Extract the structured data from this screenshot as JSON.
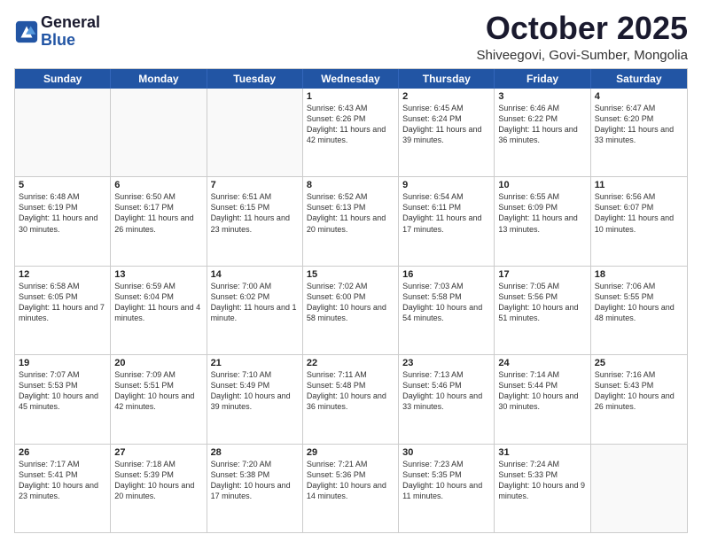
{
  "header": {
    "logo_general": "General",
    "logo_blue": "Blue",
    "month_title": "October 2025",
    "subtitle": "Shiveegovi, Govi-Sumber, Mongolia"
  },
  "days_of_week": [
    "Sunday",
    "Monday",
    "Tuesday",
    "Wednesday",
    "Thursday",
    "Friday",
    "Saturday"
  ],
  "rows": [
    [
      {
        "day": "",
        "sunrise": "",
        "sunset": "",
        "daylight": "",
        "empty": true
      },
      {
        "day": "",
        "sunrise": "",
        "sunset": "",
        "daylight": "",
        "empty": true
      },
      {
        "day": "",
        "sunrise": "",
        "sunset": "",
        "daylight": "",
        "empty": true
      },
      {
        "day": "1",
        "sunrise": "Sunrise: 6:43 AM",
        "sunset": "Sunset: 6:26 PM",
        "daylight": "Daylight: 11 hours and 42 minutes."
      },
      {
        "day": "2",
        "sunrise": "Sunrise: 6:45 AM",
        "sunset": "Sunset: 6:24 PM",
        "daylight": "Daylight: 11 hours and 39 minutes."
      },
      {
        "day": "3",
        "sunrise": "Sunrise: 6:46 AM",
        "sunset": "Sunset: 6:22 PM",
        "daylight": "Daylight: 11 hours and 36 minutes."
      },
      {
        "day": "4",
        "sunrise": "Sunrise: 6:47 AM",
        "sunset": "Sunset: 6:20 PM",
        "daylight": "Daylight: 11 hours and 33 minutes."
      }
    ],
    [
      {
        "day": "5",
        "sunrise": "Sunrise: 6:48 AM",
        "sunset": "Sunset: 6:19 PM",
        "daylight": "Daylight: 11 hours and 30 minutes."
      },
      {
        "day": "6",
        "sunrise": "Sunrise: 6:50 AM",
        "sunset": "Sunset: 6:17 PM",
        "daylight": "Daylight: 11 hours and 26 minutes."
      },
      {
        "day": "7",
        "sunrise": "Sunrise: 6:51 AM",
        "sunset": "Sunset: 6:15 PM",
        "daylight": "Daylight: 11 hours and 23 minutes."
      },
      {
        "day": "8",
        "sunrise": "Sunrise: 6:52 AM",
        "sunset": "Sunset: 6:13 PM",
        "daylight": "Daylight: 11 hours and 20 minutes."
      },
      {
        "day": "9",
        "sunrise": "Sunrise: 6:54 AM",
        "sunset": "Sunset: 6:11 PM",
        "daylight": "Daylight: 11 hours and 17 minutes."
      },
      {
        "day": "10",
        "sunrise": "Sunrise: 6:55 AM",
        "sunset": "Sunset: 6:09 PM",
        "daylight": "Daylight: 11 hours and 13 minutes."
      },
      {
        "day": "11",
        "sunrise": "Sunrise: 6:56 AM",
        "sunset": "Sunset: 6:07 PM",
        "daylight": "Daylight: 11 hours and 10 minutes."
      }
    ],
    [
      {
        "day": "12",
        "sunrise": "Sunrise: 6:58 AM",
        "sunset": "Sunset: 6:05 PM",
        "daylight": "Daylight: 11 hours and 7 minutes."
      },
      {
        "day": "13",
        "sunrise": "Sunrise: 6:59 AM",
        "sunset": "Sunset: 6:04 PM",
        "daylight": "Daylight: 11 hours and 4 minutes."
      },
      {
        "day": "14",
        "sunrise": "Sunrise: 7:00 AM",
        "sunset": "Sunset: 6:02 PM",
        "daylight": "Daylight: 11 hours and 1 minute."
      },
      {
        "day": "15",
        "sunrise": "Sunrise: 7:02 AM",
        "sunset": "Sunset: 6:00 PM",
        "daylight": "Daylight: 10 hours and 58 minutes."
      },
      {
        "day": "16",
        "sunrise": "Sunrise: 7:03 AM",
        "sunset": "Sunset: 5:58 PM",
        "daylight": "Daylight: 10 hours and 54 minutes."
      },
      {
        "day": "17",
        "sunrise": "Sunrise: 7:05 AM",
        "sunset": "Sunset: 5:56 PM",
        "daylight": "Daylight: 10 hours and 51 minutes."
      },
      {
        "day": "18",
        "sunrise": "Sunrise: 7:06 AM",
        "sunset": "Sunset: 5:55 PM",
        "daylight": "Daylight: 10 hours and 48 minutes."
      }
    ],
    [
      {
        "day": "19",
        "sunrise": "Sunrise: 7:07 AM",
        "sunset": "Sunset: 5:53 PM",
        "daylight": "Daylight: 10 hours and 45 minutes."
      },
      {
        "day": "20",
        "sunrise": "Sunrise: 7:09 AM",
        "sunset": "Sunset: 5:51 PM",
        "daylight": "Daylight: 10 hours and 42 minutes."
      },
      {
        "day": "21",
        "sunrise": "Sunrise: 7:10 AM",
        "sunset": "Sunset: 5:49 PM",
        "daylight": "Daylight: 10 hours and 39 minutes."
      },
      {
        "day": "22",
        "sunrise": "Sunrise: 7:11 AM",
        "sunset": "Sunset: 5:48 PM",
        "daylight": "Daylight: 10 hours and 36 minutes."
      },
      {
        "day": "23",
        "sunrise": "Sunrise: 7:13 AM",
        "sunset": "Sunset: 5:46 PM",
        "daylight": "Daylight: 10 hours and 33 minutes."
      },
      {
        "day": "24",
        "sunrise": "Sunrise: 7:14 AM",
        "sunset": "Sunset: 5:44 PM",
        "daylight": "Daylight: 10 hours and 30 minutes."
      },
      {
        "day": "25",
        "sunrise": "Sunrise: 7:16 AM",
        "sunset": "Sunset: 5:43 PM",
        "daylight": "Daylight: 10 hours and 26 minutes."
      }
    ],
    [
      {
        "day": "26",
        "sunrise": "Sunrise: 7:17 AM",
        "sunset": "Sunset: 5:41 PM",
        "daylight": "Daylight: 10 hours and 23 minutes."
      },
      {
        "day": "27",
        "sunrise": "Sunrise: 7:18 AM",
        "sunset": "Sunset: 5:39 PM",
        "daylight": "Daylight: 10 hours and 20 minutes."
      },
      {
        "day": "28",
        "sunrise": "Sunrise: 7:20 AM",
        "sunset": "Sunset: 5:38 PM",
        "daylight": "Daylight: 10 hours and 17 minutes."
      },
      {
        "day": "29",
        "sunrise": "Sunrise: 7:21 AM",
        "sunset": "Sunset: 5:36 PM",
        "daylight": "Daylight: 10 hours and 14 minutes."
      },
      {
        "day": "30",
        "sunrise": "Sunrise: 7:23 AM",
        "sunset": "Sunset: 5:35 PM",
        "daylight": "Daylight: 10 hours and 11 minutes."
      },
      {
        "day": "31",
        "sunrise": "Sunrise: 7:24 AM",
        "sunset": "Sunset: 5:33 PM",
        "daylight": "Daylight: 10 hours and 9 minutes."
      },
      {
        "day": "",
        "sunrise": "",
        "sunset": "",
        "daylight": "",
        "empty": true
      }
    ]
  ]
}
